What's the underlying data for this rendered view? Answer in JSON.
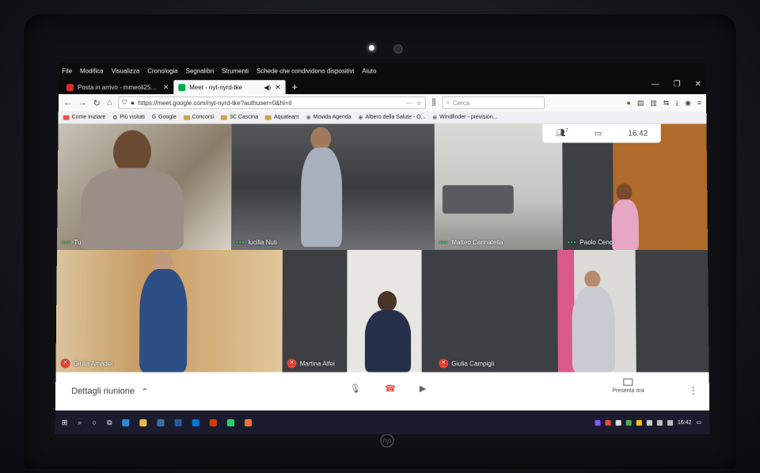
{
  "menu": [
    "File",
    "Modifica",
    "Visualizza",
    "Cronologia",
    "Segnalibri",
    "Strumenti",
    "Schede che condividono dispositivi",
    "Aiuto"
  ],
  "tabs": [
    {
      "label": "Posta in arrivo - mmeoli25@g",
      "icon": "gmail-icon",
      "color": "#d93025"
    },
    {
      "label": "Meet - nyt-nyrd-tke",
      "icon": "meet-icon",
      "color": "#00ac47"
    }
  ],
  "url": "https://meet.google.com/nyt-nyrd-tke?authuser=0&hl=it",
  "search_placeholder": "Cerca",
  "bookmarks": [
    "Come iniziare",
    "Più visitati",
    "Google",
    "Concorsi",
    "3C Cascina",
    "Aquateam",
    "Movida Agenda",
    "Albero della Salute - O...",
    "Windfinder - prevision..."
  ],
  "meet": {
    "time": "16:42",
    "participants_badge": "7",
    "tiles": [
      {
        "name": "Tu",
        "muted": false
      },
      {
        "name": "lucilla Nuti",
        "muted": false
      },
      {
        "name": "Matteo Cannatella",
        "muted": false
      },
      {
        "name": "Paolo Cenci",
        "muted": false
      },
      {
        "name": "Giulia Amadei",
        "muted": true
      },
      {
        "name": "Martina Alfei",
        "muted": true
      },
      {
        "name": "Giulia Campigli",
        "muted": true
      }
    ],
    "details_label": "Dettagli riunione",
    "present_label": "Presenta ora"
  },
  "taskbar": {
    "clock": "16:42"
  },
  "colors": {
    "meet_bg": "#202124",
    "mute_red": "#ea4335",
    "active_green": "#34c759"
  }
}
